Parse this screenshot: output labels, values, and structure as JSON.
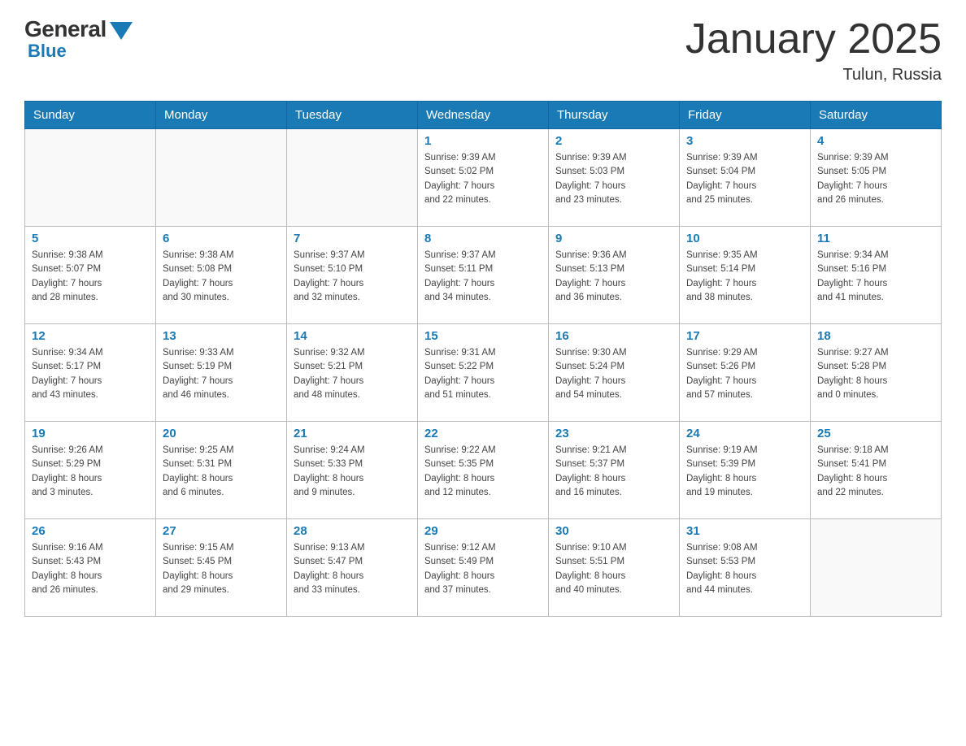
{
  "header": {
    "logo_general": "General",
    "logo_blue": "Blue",
    "title": "January 2025",
    "location": "Tulun, Russia"
  },
  "weekdays": [
    "Sunday",
    "Monday",
    "Tuesday",
    "Wednesday",
    "Thursday",
    "Friday",
    "Saturday"
  ],
  "weeks": [
    [
      {
        "day": "",
        "info": ""
      },
      {
        "day": "",
        "info": ""
      },
      {
        "day": "",
        "info": ""
      },
      {
        "day": "1",
        "info": "Sunrise: 9:39 AM\nSunset: 5:02 PM\nDaylight: 7 hours\nand 22 minutes."
      },
      {
        "day": "2",
        "info": "Sunrise: 9:39 AM\nSunset: 5:03 PM\nDaylight: 7 hours\nand 23 minutes."
      },
      {
        "day": "3",
        "info": "Sunrise: 9:39 AM\nSunset: 5:04 PM\nDaylight: 7 hours\nand 25 minutes."
      },
      {
        "day": "4",
        "info": "Sunrise: 9:39 AM\nSunset: 5:05 PM\nDaylight: 7 hours\nand 26 minutes."
      }
    ],
    [
      {
        "day": "5",
        "info": "Sunrise: 9:38 AM\nSunset: 5:07 PM\nDaylight: 7 hours\nand 28 minutes."
      },
      {
        "day": "6",
        "info": "Sunrise: 9:38 AM\nSunset: 5:08 PM\nDaylight: 7 hours\nand 30 minutes."
      },
      {
        "day": "7",
        "info": "Sunrise: 9:37 AM\nSunset: 5:10 PM\nDaylight: 7 hours\nand 32 minutes."
      },
      {
        "day": "8",
        "info": "Sunrise: 9:37 AM\nSunset: 5:11 PM\nDaylight: 7 hours\nand 34 minutes."
      },
      {
        "day": "9",
        "info": "Sunrise: 9:36 AM\nSunset: 5:13 PM\nDaylight: 7 hours\nand 36 minutes."
      },
      {
        "day": "10",
        "info": "Sunrise: 9:35 AM\nSunset: 5:14 PM\nDaylight: 7 hours\nand 38 minutes."
      },
      {
        "day": "11",
        "info": "Sunrise: 9:34 AM\nSunset: 5:16 PM\nDaylight: 7 hours\nand 41 minutes."
      }
    ],
    [
      {
        "day": "12",
        "info": "Sunrise: 9:34 AM\nSunset: 5:17 PM\nDaylight: 7 hours\nand 43 minutes."
      },
      {
        "day": "13",
        "info": "Sunrise: 9:33 AM\nSunset: 5:19 PM\nDaylight: 7 hours\nand 46 minutes."
      },
      {
        "day": "14",
        "info": "Sunrise: 9:32 AM\nSunset: 5:21 PM\nDaylight: 7 hours\nand 48 minutes."
      },
      {
        "day": "15",
        "info": "Sunrise: 9:31 AM\nSunset: 5:22 PM\nDaylight: 7 hours\nand 51 minutes."
      },
      {
        "day": "16",
        "info": "Sunrise: 9:30 AM\nSunset: 5:24 PM\nDaylight: 7 hours\nand 54 minutes."
      },
      {
        "day": "17",
        "info": "Sunrise: 9:29 AM\nSunset: 5:26 PM\nDaylight: 7 hours\nand 57 minutes."
      },
      {
        "day": "18",
        "info": "Sunrise: 9:27 AM\nSunset: 5:28 PM\nDaylight: 8 hours\nand 0 minutes."
      }
    ],
    [
      {
        "day": "19",
        "info": "Sunrise: 9:26 AM\nSunset: 5:29 PM\nDaylight: 8 hours\nand 3 minutes."
      },
      {
        "day": "20",
        "info": "Sunrise: 9:25 AM\nSunset: 5:31 PM\nDaylight: 8 hours\nand 6 minutes."
      },
      {
        "day": "21",
        "info": "Sunrise: 9:24 AM\nSunset: 5:33 PM\nDaylight: 8 hours\nand 9 minutes."
      },
      {
        "day": "22",
        "info": "Sunrise: 9:22 AM\nSunset: 5:35 PM\nDaylight: 8 hours\nand 12 minutes."
      },
      {
        "day": "23",
        "info": "Sunrise: 9:21 AM\nSunset: 5:37 PM\nDaylight: 8 hours\nand 16 minutes."
      },
      {
        "day": "24",
        "info": "Sunrise: 9:19 AM\nSunset: 5:39 PM\nDaylight: 8 hours\nand 19 minutes."
      },
      {
        "day": "25",
        "info": "Sunrise: 9:18 AM\nSunset: 5:41 PM\nDaylight: 8 hours\nand 22 minutes."
      }
    ],
    [
      {
        "day": "26",
        "info": "Sunrise: 9:16 AM\nSunset: 5:43 PM\nDaylight: 8 hours\nand 26 minutes."
      },
      {
        "day": "27",
        "info": "Sunrise: 9:15 AM\nSunset: 5:45 PM\nDaylight: 8 hours\nand 29 minutes."
      },
      {
        "day": "28",
        "info": "Sunrise: 9:13 AM\nSunset: 5:47 PM\nDaylight: 8 hours\nand 33 minutes."
      },
      {
        "day": "29",
        "info": "Sunrise: 9:12 AM\nSunset: 5:49 PM\nDaylight: 8 hours\nand 37 minutes."
      },
      {
        "day": "30",
        "info": "Sunrise: 9:10 AM\nSunset: 5:51 PM\nDaylight: 8 hours\nand 40 minutes."
      },
      {
        "day": "31",
        "info": "Sunrise: 9:08 AM\nSunset: 5:53 PM\nDaylight: 8 hours\nand 44 minutes."
      },
      {
        "day": "",
        "info": ""
      }
    ]
  ]
}
